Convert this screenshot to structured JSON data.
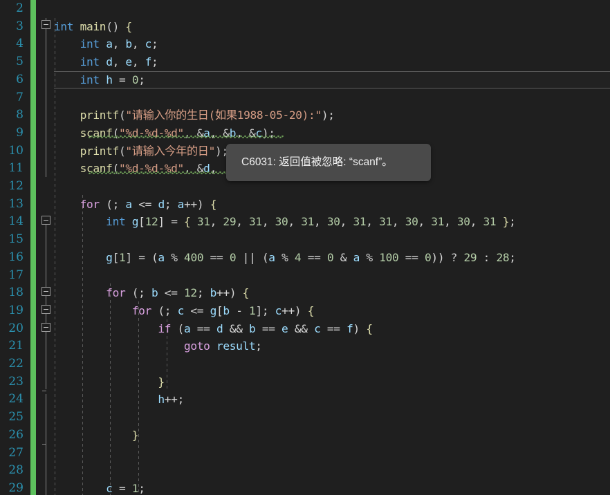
{
  "editor": {
    "theme_name": "dark-plus",
    "background_color": "#1f1f1f",
    "line_number_color": "#2b91af",
    "change_bar_color": "#5dc15d",
    "current_line": 6,
    "first_visible_line": 2,
    "last_visible_line": 29,
    "line_numbers": [
      "2",
      "3",
      "4",
      "5",
      "6",
      "7",
      "8",
      "9",
      "10",
      "11",
      "12",
      "13",
      "14",
      "15",
      "16",
      "17",
      "18",
      "19",
      "20",
      "21",
      "22",
      "23",
      "24",
      "25",
      "26",
      "27",
      "28",
      "29"
    ]
  },
  "code": {
    "lines": [
      {
        "n": "2",
        "text": ""
      },
      {
        "n": "3",
        "text": "int main() {"
      },
      {
        "n": "4",
        "text": "    int a, b, c;"
      },
      {
        "n": "5",
        "text": "    int d, e, f;"
      },
      {
        "n": "6",
        "text": "    int h = 0;"
      },
      {
        "n": "7",
        "text": ""
      },
      {
        "n": "8",
        "text": "    printf(\"请输入你的生日(如果1988-05-20):\");"
      },
      {
        "n": "9",
        "text": "    scanf(\"%d-%d-%d\", &a, &b, &c);"
      },
      {
        "n": "10",
        "text": "    printf(\"请输入今年的日\");"
      },
      {
        "n": "11",
        "text": "    scanf(\"%d-%d-%d\", &d,"
      },
      {
        "n": "12",
        "text": ""
      },
      {
        "n": "13",
        "text": "    for (; a <= d; a++) {"
      },
      {
        "n": "14",
        "text": "        int g[12] = { 31, 29, 31, 30, 31, 30, 31, 31, 30, 31, 30, 31 };"
      },
      {
        "n": "15",
        "text": ""
      },
      {
        "n": "16",
        "text": "        g[1] = (a % 400 == 0 || (a % 4 == 0 & a % 100 == 0)) ? 29 : 28;"
      },
      {
        "n": "17",
        "text": ""
      },
      {
        "n": "18",
        "text": "        for (; b <= 12; b++) {"
      },
      {
        "n": "19",
        "text": "            for (; c <= g[b - 1]; c++) {"
      },
      {
        "n": "20",
        "text": "                if (a == d && b == e && c == f) {"
      },
      {
        "n": "21",
        "text": "                    goto result;"
      },
      {
        "n": "22",
        "text": ""
      },
      {
        "n": "23",
        "text": "                }"
      },
      {
        "n": "24",
        "text": "                h++;"
      },
      {
        "n": "25",
        "text": ""
      },
      {
        "n": "26",
        "text": "            }"
      },
      {
        "n": "27",
        "text": ""
      },
      {
        "n": "28",
        "text": ""
      },
      {
        "n": "29",
        "text": "        c = 1;"
      }
    ]
  },
  "tooltip": {
    "text": "C6031: 返回值被忽略: “scanf”。",
    "code": "C6031",
    "background_color": "#4a4a4a",
    "text_color": "#f2f2f2"
  },
  "fold_markers": {
    "expanded_lines": [
      "3",
      "13",
      "18",
      "19",
      "20"
    ],
    "glyph": "minus-box"
  },
  "diagnostics": {
    "squiggle_color": "#6a9955",
    "squiggle_lines": [
      "9",
      "11"
    ],
    "severity": "warning"
  }
}
